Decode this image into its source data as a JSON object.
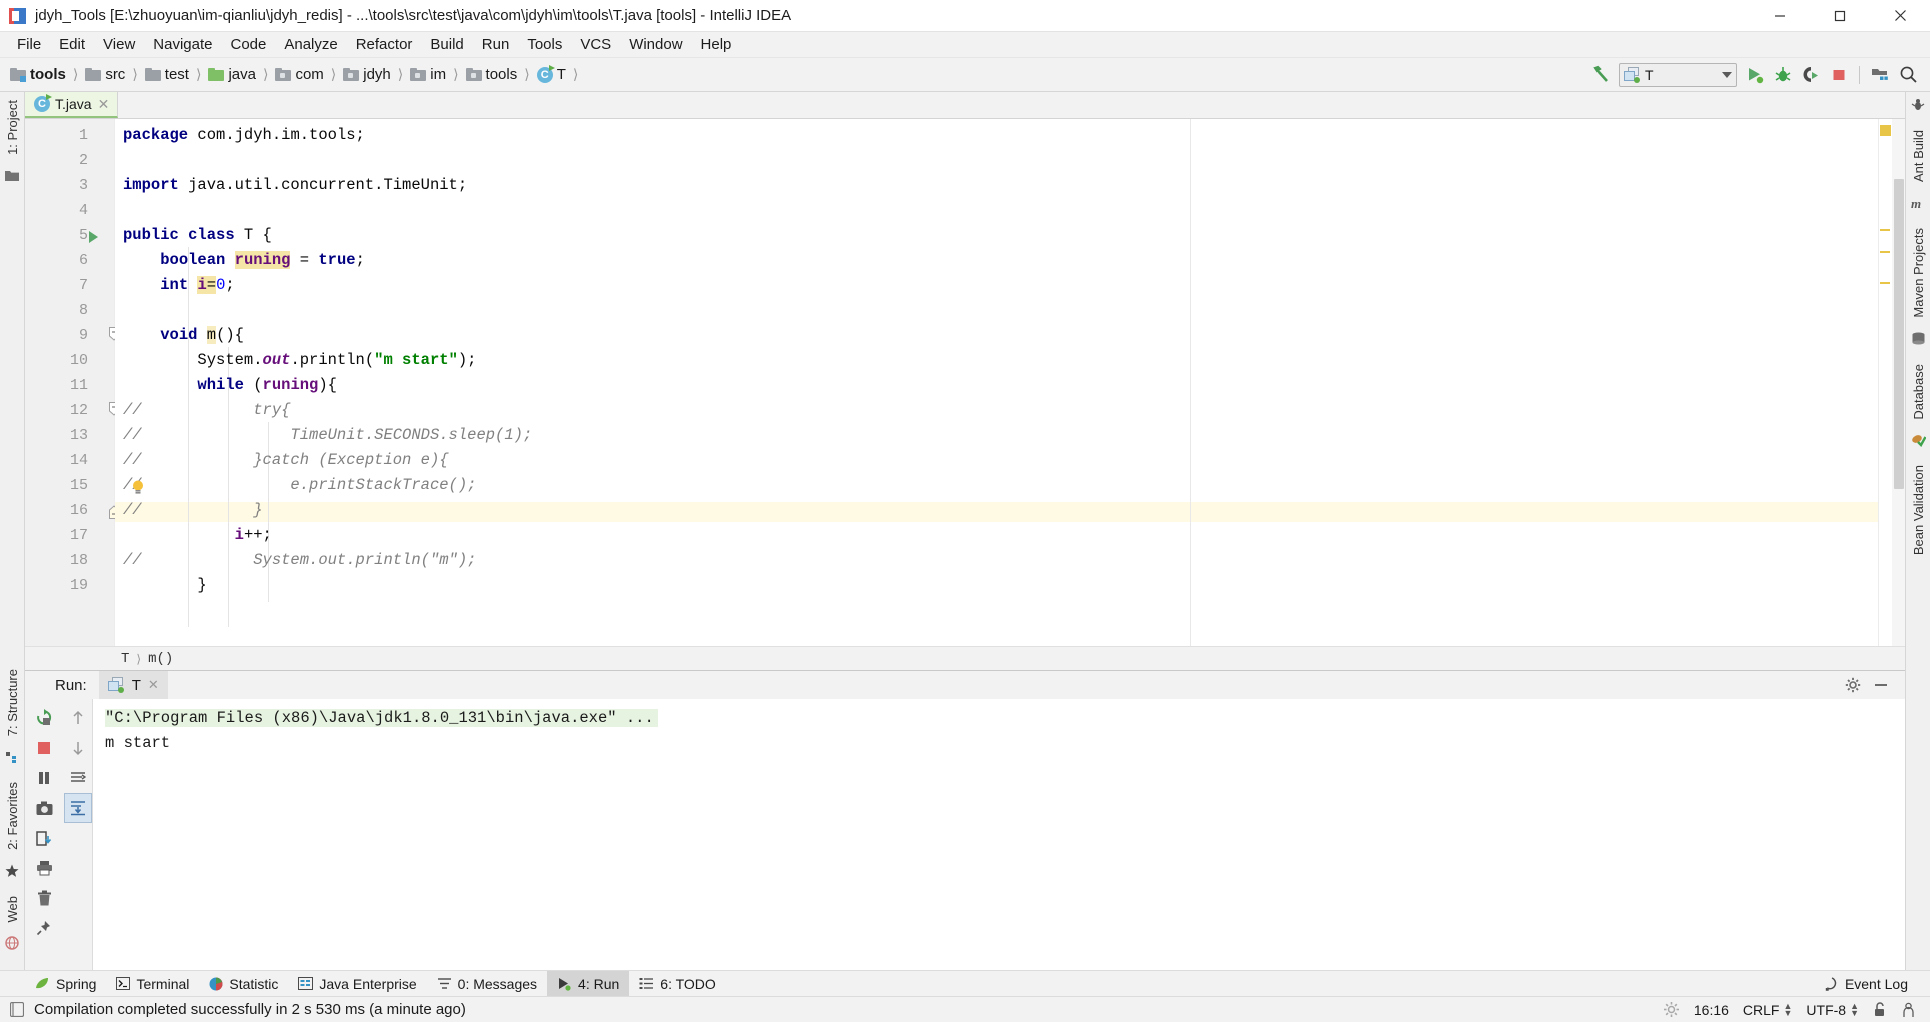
{
  "window": {
    "title": "jdyh_Tools [E:\\zhuoyuan\\im-qianliu\\jdyh_redis] - ...\\tools\\src\\test\\java\\com\\jdyh\\im\\tools\\T.java [tools] - IntelliJ IDEA",
    "minimize": "minimize-button",
    "maximize": "maximize-button",
    "close": "close-button"
  },
  "menu": {
    "items": [
      "File",
      "Edit",
      "View",
      "Navigate",
      "Code",
      "Analyze",
      "Refactor",
      "Build",
      "Run",
      "Tools",
      "VCS",
      "Window",
      "Help"
    ]
  },
  "breadcrumbs": {
    "items": [
      {
        "label": "tools",
        "icon": "module-folder-icon",
        "bold": true
      },
      {
        "label": "src",
        "icon": "folder-icon",
        "bold": false
      },
      {
        "label": "test",
        "icon": "folder-icon",
        "bold": false
      },
      {
        "label": "java",
        "icon": "source-folder-icon",
        "bold": false
      },
      {
        "label": "com",
        "icon": "package-folder-icon",
        "bold": false
      },
      {
        "label": "jdyh",
        "icon": "package-folder-icon",
        "bold": false
      },
      {
        "label": "im",
        "icon": "package-folder-icon",
        "bold": false
      },
      {
        "label": "tools",
        "icon": "package-folder-icon",
        "bold": false
      },
      {
        "label": "T",
        "icon": "java-class-icon",
        "bold": false
      }
    ]
  },
  "toolbar": {
    "build_label": "build-hammer-icon",
    "run_config": "T",
    "buttons": [
      "run-button",
      "debug-button",
      "run-with-coverage-button",
      "stop-button",
      "project-structure-button",
      "search-everywhere-button"
    ]
  },
  "left_rail": {
    "project_tab": "1: Project",
    "structure_tab": "7: Structure",
    "favorites_tab": "2: Favorites",
    "web_tab": "Web"
  },
  "right_rail": {
    "tabs": [
      "Ant Build",
      "Maven Projects",
      "Database",
      "Bean Validation"
    ]
  },
  "editor": {
    "tab_name": "T.java",
    "tab_icon": "java-class-runnable-icon",
    "close_icon": "close-icon",
    "breadcrumb": [
      "T",
      "m()"
    ],
    "current_line": 16,
    "gutter_run_line": 5,
    "bulb_line": 15,
    "lines": [
      {
        "n": 1,
        "text": "package com.jdyh.im.tools;"
      },
      {
        "n": 2,
        "text": ""
      },
      {
        "n": 3,
        "text": "import java.util.concurrent.TimeUnit;"
      },
      {
        "n": 4,
        "text": ""
      },
      {
        "n": 5,
        "text": "public class T {"
      },
      {
        "n": 6,
        "text": "    boolean runing = true;"
      },
      {
        "n": 7,
        "text": "    int i=0;"
      },
      {
        "n": 8,
        "text": ""
      },
      {
        "n": 9,
        "text": "    void m(){"
      },
      {
        "n": 10,
        "text": "        System.out.println(\"m start\");"
      },
      {
        "n": 11,
        "text": "        while (runing){"
      },
      {
        "n": 12,
        "text": "//            try{"
      },
      {
        "n": 13,
        "text": "//                TimeUnit.SECONDS.sleep(1);"
      },
      {
        "n": 14,
        "text": "//            }catch (Exception e){"
      },
      {
        "n": 15,
        "text": "//                e.printStackTrace();"
      },
      {
        "n": 16,
        "text": "//            }"
      },
      {
        "n": 17,
        "text": "            i++;"
      },
      {
        "n": 18,
        "text": "//            System.out.println(\"m\");"
      },
      {
        "n": 19,
        "text": "        }"
      }
    ]
  },
  "run_panel": {
    "label": "Run:",
    "tab_name": "T",
    "tab_icon": "run-config-icon",
    "close_icon": "close-icon",
    "settings_icon": "gear-icon",
    "hide_icon": "minimize-icon",
    "toolbar_buttons": [
      "rerun-icon",
      "stop-icon",
      "pause-icon",
      "camera-icon",
      "export-icon",
      "print-icon",
      "trash-icon",
      "pin-icon"
    ],
    "toolbar_buttons2": [
      "scroll-up-icon",
      "scroll-down-icon",
      "soft-wrap-icon",
      "scroll-to-end-icon"
    ],
    "console": {
      "command": "\"C:\\Program Files (x86)\\Java\\jdk1.8.0_131\\bin\\java.exe\" ...",
      "output": [
        "m start"
      ]
    }
  },
  "bottom_bar": {
    "tabs": [
      {
        "label": "Spring",
        "icon": "spring-leaf-icon",
        "selected": false,
        "mnemonic": ""
      },
      {
        "label": "Terminal",
        "icon": "terminal-icon",
        "selected": false,
        "mnemonic": ""
      },
      {
        "label": "Statistic",
        "icon": "statistic-icon",
        "selected": false,
        "mnemonic": ""
      },
      {
        "label": "Java Enterprise",
        "icon": "java-enterprise-icon",
        "selected": false,
        "mnemonic": ""
      },
      {
        "label": "0: Messages",
        "icon": "messages-icon",
        "selected": false,
        "mnemonic": "0"
      },
      {
        "label": "4: Run",
        "icon": "run-icon",
        "selected": true,
        "mnemonic": "4"
      },
      {
        "label": "6: TODO",
        "icon": "todo-icon",
        "selected": false,
        "mnemonic": "6"
      }
    ],
    "event_log": "Event Log",
    "event_log_icon": "event-log-icon"
  },
  "status_bar": {
    "message": "Compilation completed successfully in 2 s 530 ms (a minute ago)",
    "message_icon": "build-status-icon",
    "background_tasks_icon": "gear-icon",
    "caret_position": "16:16",
    "line_separator": "CRLF",
    "encoding": "UTF-8",
    "lock_icon": "unlocked-icon",
    "inspection_icon": "inspector-icon"
  }
}
